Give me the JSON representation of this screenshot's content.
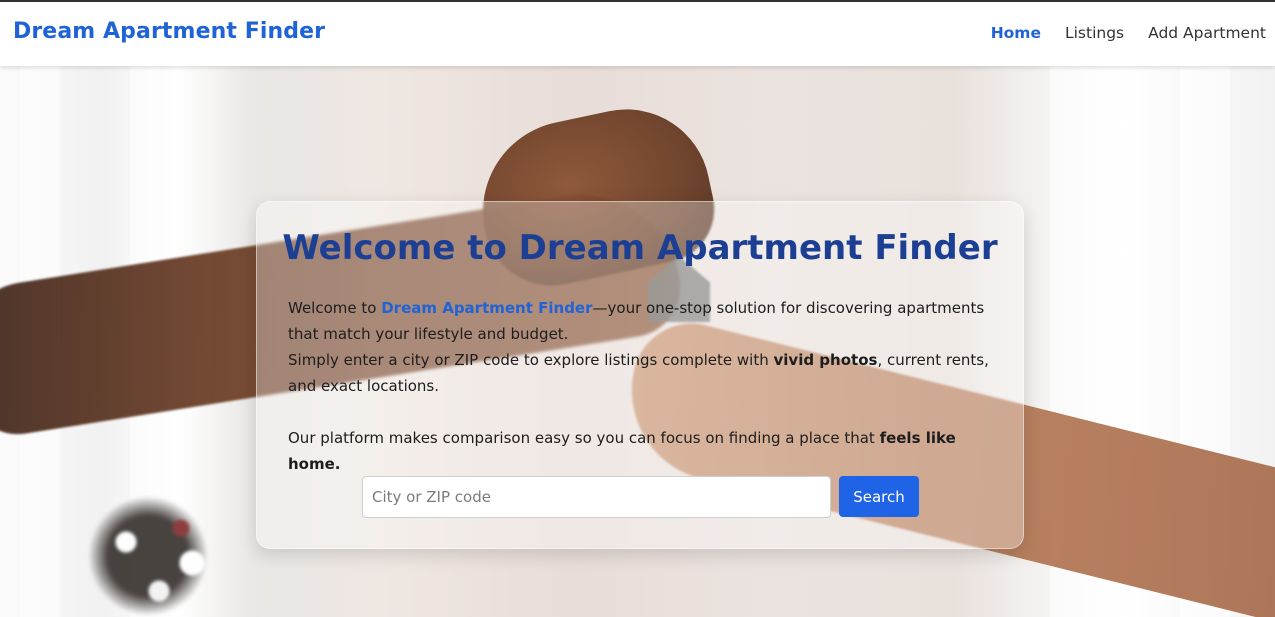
{
  "navbar": {
    "brand": "Dream Apartment Finder",
    "links": [
      {
        "label": "Home",
        "active": true
      },
      {
        "label": "Listings",
        "active": false
      },
      {
        "label": "Add Apartment",
        "active": false
      }
    ]
  },
  "hero": {
    "title": "Welcome to Dream Apartment Finder",
    "paragraph1": {
      "prefix": "Welcome to ",
      "brand": "Dream Apartment Finder",
      "suffix": "—your one-stop solution for discovering apartments that match your lifestyle and budget."
    },
    "paragraph2": {
      "prefix": "Simply enter a city or ZIP code to explore listings complete with ",
      "bold": "vivid photos",
      "suffix": ", current rents, and exact locations."
    },
    "paragraph3": {
      "prefix": "Our platform makes comparison easy so you can focus on finding a place that ",
      "bold": "feels like home."
    },
    "search": {
      "placeholder": "City or ZIP code",
      "value": "",
      "button_label": "Search"
    }
  },
  "colors": {
    "brand": "#1f63d6",
    "title": "#1d3f93",
    "button": "#1f63e6"
  }
}
